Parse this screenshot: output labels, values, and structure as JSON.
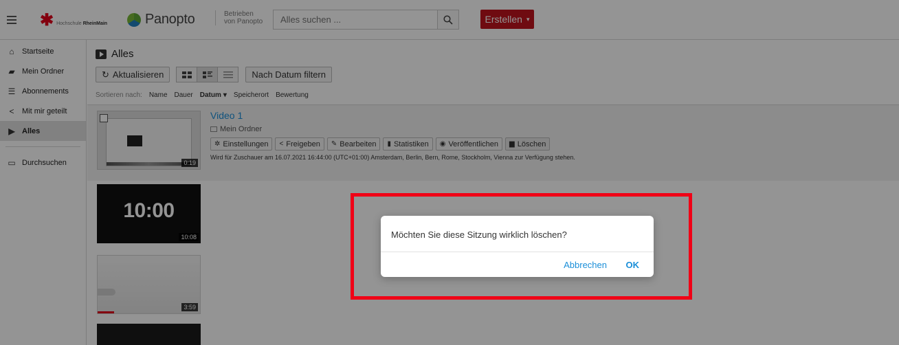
{
  "header": {
    "logo_prefix": "Hochschule",
    "logo_name": "RheinMain",
    "brand": "Panopto",
    "powered_line1": "Betrieben",
    "powered_line2": "von Panopto",
    "search_placeholder": "Alles suchen ...",
    "create_label": "Erstellen"
  },
  "sidebar": {
    "items": [
      {
        "label": "Startseite",
        "icon": "home-icon"
      },
      {
        "label": "Mein Ordner",
        "icon": "star-folder-icon"
      },
      {
        "label": "Abonnements",
        "icon": "subscriptions-icon"
      },
      {
        "label": "Mit mir geteilt",
        "icon": "share-icon"
      },
      {
        "label": "Alles",
        "icon": "play-icon",
        "active": true
      },
      {
        "label": "Durchsuchen",
        "icon": "folder-icon"
      }
    ]
  },
  "main": {
    "title": "Alles",
    "refresh_label": "Aktualisieren",
    "filter_label": "Nach Datum filtern",
    "sort": {
      "label": "Sortieren nach:",
      "options": [
        "Name",
        "Dauer",
        "Datum",
        "Speicherort",
        "Bewertung"
      ],
      "active": "Datum"
    },
    "sessions": [
      {
        "title": "Video 1",
        "folder": "Mein Ordner",
        "duration": "0:19",
        "availability": "Wird für Zuschauer am 16.07.2021 16:44:00 (UTC+01:00) Amsterdam, Berlin, Bern, Rome, Stockholm, Vienna zur Verfügung stehen.",
        "actions": [
          "Einstellungen",
          "Freigeben",
          "Bearbeiten",
          "Statistiken",
          "Veröffentlichen",
          "Löschen"
        ]
      },
      {
        "thumb_text": "10:00",
        "duration": "10:08"
      },
      {
        "duration": "3:59"
      }
    ]
  },
  "dialog": {
    "message": "Möchten Sie diese Sitzung wirklich löschen?",
    "cancel_label": "Abbrechen",
    "ok_label": "OK"
  },
  "colors": {
    "accent": "#1a8ed8",
    "create": "#c0131e",
    "highlight": "#f00016"
  }
}
